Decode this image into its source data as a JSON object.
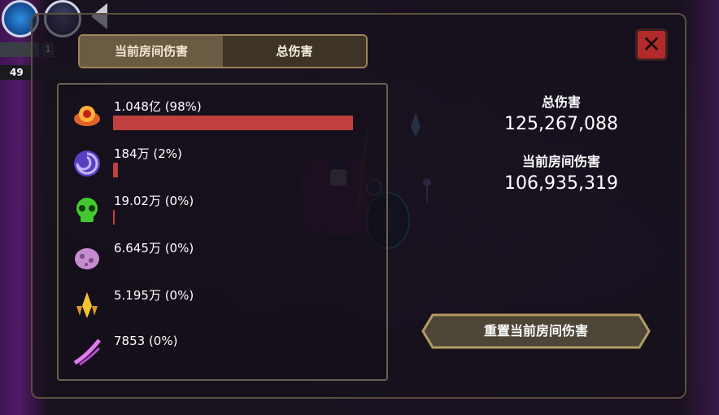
{
  "hud": {
    "level": "1",
    "exp_value": "49"
  },
  "tabs": [
    {
      "label": "当前房间伤害",
      "active": true
    },
    {
      "label": "总伤害",
      "active": false
    }
  ],
  "close_label": "✕",
  "damage_list": [
    {
      "text": "1.048亿 (98%)",
      "share": 0.98,
      "icon": "flame-skull-icon"
    },
    {
      "text": "184万 (2%)",
      "share": 0.02,
      "icon": "swirl-orb-icon"
    },
    {
      "text": "19.02万 (0%)",
      "share": 0.004,
      "icon": "green-skull-icon"
    },
    {
      "text": "6.645万 (0%)",
      "share": 0,
      "icon": "pink-blob-icon"
    },
    {
      "text": "5.195万 (0%)",
      "share": 0,
      "icon": "gold-crystal-icon"
    },
    {
      "text": "7853 (0%)",
      "share": 0,
      "icon": "purple-slash-icon"
    }
  ],
  "stats": {
    "total_label": "总伤害",
    "total_value": "125,267,088",
    "room_label": "当前房间伤害",
    "room_value": "106,935,319"
  },
  "reset_button": "重置当前房间伤害",
  "colors": {
    "bar": "#c0403f",
    "panel_border": "#9c8459",
    "close": "#b32a2a"
  }
}
